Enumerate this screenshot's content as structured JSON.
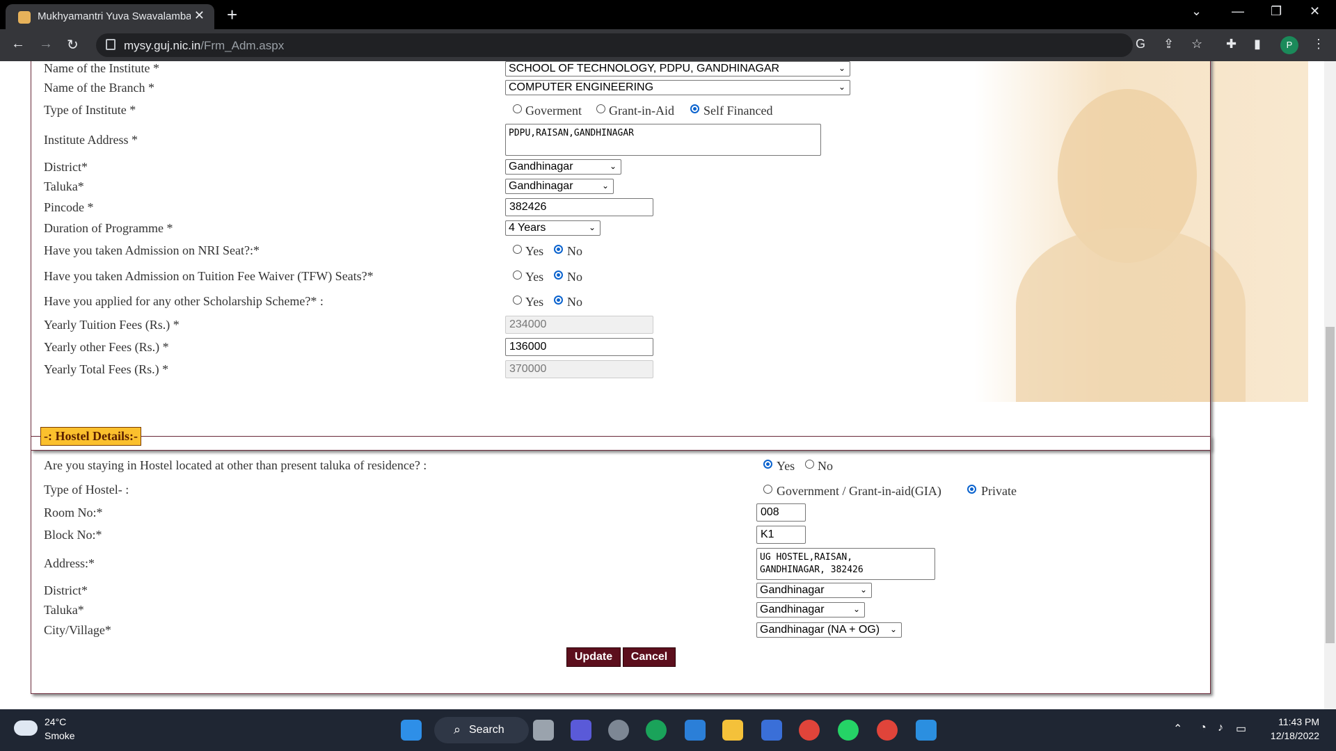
{
  "browser": {
    "tab_title": "Mukhyamantri Yuva Swavalamba",
    "url_domain": "mysy.guj.nic.in",
    "url_path": "/Frm_Adm.aspx",
    "profile_initial": "P"
  },
  "institute": {
    "name_label": "Name of the Institute *",
    "name_value": "SCHOOL OF TECHNOLOGY, PDPU, GANDHINAGAR",
    "branch_label": "Name of the Branch *",
    "branch_value": "COMPUTER ENGINEERING",
    "type_label": "Type of Institute *",
    "type_options": [
      "Goverment",
      "Grant-in-Aid",
      "Self Financed"
    ],
    "type_selected": "Self Financed",
    "address_label": "Institute Address *",
    "address_value": "PDPU,RAISAN,GANDHINAGAR",
    "district_label": "District*",
    "district_value": "Gandhinagar",
    "taluka_label": "Taluka*",
    "taluka_value": "Gandhinagar",
    "pincode_label": "Pincode *",
    "pincode_value": "382426",
    "duration_label": "Duration of Programme *",
    "duration_value": "4 Years",
    "nri_label": "Have you taken Admission on NRI Seat?:*",
    "tfw_label": "Have you taken Admission on Tuition Fee Waiver (TFW) Seats?*",
    "scholarship_label": "Have you applied for any other Scholarship Scheme?* :",
    "yes_label": "Yes",
    "no_label": "No",
    "tuition_label": "Yearly Tuition Fees (Rs.) *",
    "tuition_value": "234000",
    "other_fees_label": "Yearly other Fees (Rs.) *",
    "other_fees_value": "136000",
    "total_label": "Yearly Total Fees (Rs.) *",
    "total_value": "370000"
  },
  "hostel": {
    "legend": "-: Hostel Details:-",
    "staying_label": "Are you staying in Hostel located at other than present  taluka of residence? :",
    "yes_label": "Yes",
    "no_label": "No",
    "type_label": "Type of Hostel- :",
    "type_option_gov": "Government / Grant-in-aid(GIA)",
    "type_option_private": "Private",
    "room_label": "Room No:*",
    "room_value": "008",
    "block_label": "Block No:*",
    "block_value": "K1",
    "address_label": "Address:*",
    "address_value": "UG HOSTEL,RAISAN,\nGANDHINAGAR, 382426",
    "district_label": "District*",
    "district_value": "Gandhinagar",
    "taluka_label": "Taluka*",
    "taluka_value": "Gandhinagar",
    "city_label": "City/Village*",
    "city_value": "Gandhinagar (NA + OG)",
    "update_label": "Update",
    "cancel_label": "Cancel"
  },
  "taskbar": {
    "temperature": "24°C",
    "condition": "Smoke",
    "search_label": "Search",
    "time": "11:43 PM",
    "date": "12/18/2022"
  }
}
